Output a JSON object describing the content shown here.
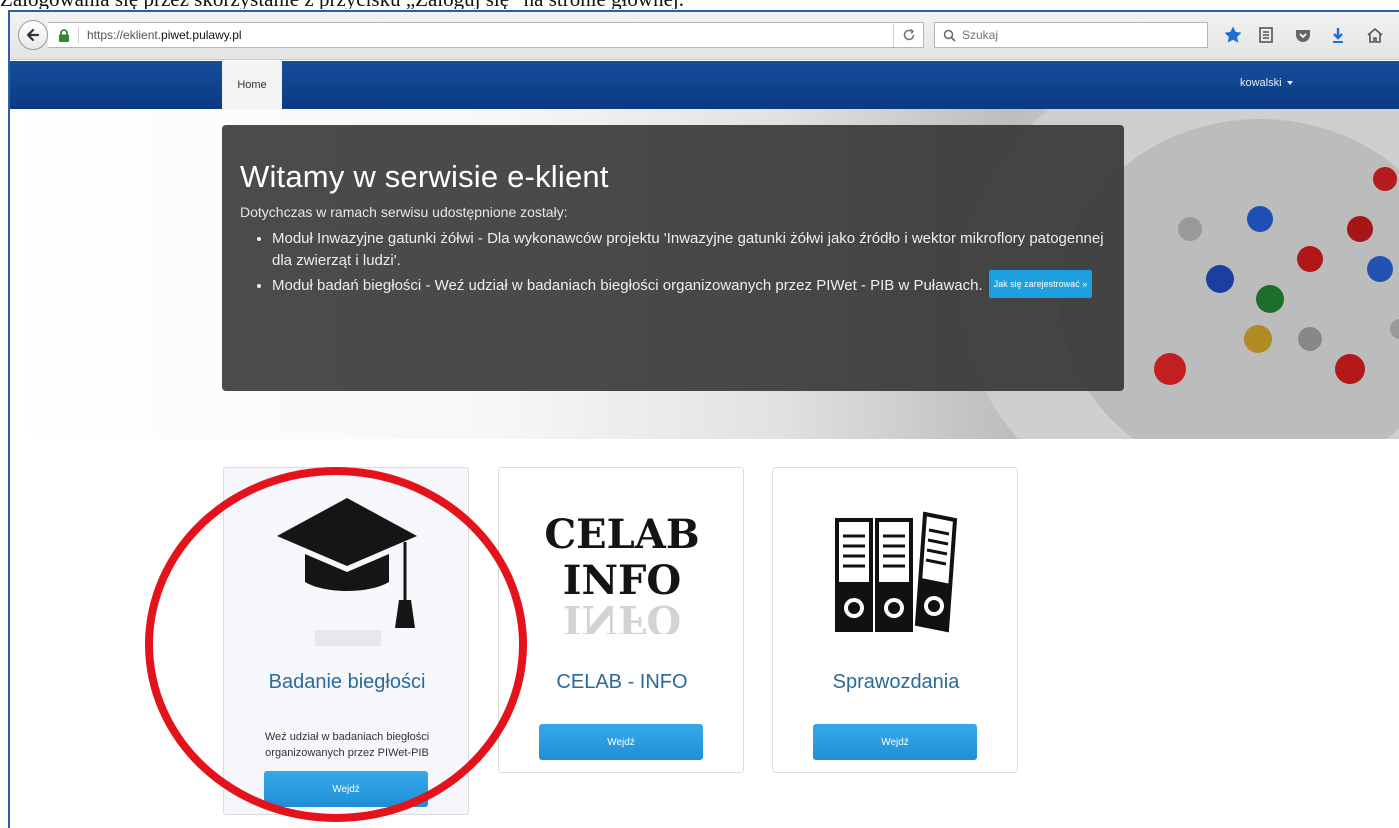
{
  "caption": "Zalogowania się przez skorzystanie z przycisku „Zaloguj się” na stronie głównej.",
  "browser": {
    "url_prefix": "https://eklient.",
    "url_domain": "piwet.pulawy.pl",
    "search_placeholder": "Szukaj"
  },
  "nav": {
    "home": "Home",
    "user": "kowalski"
  },
  "hero": {
    "title": "Witamy w serwisie e-klient",
    "subtitle": "Dotychczas w ramach serwisu udostępnione zostały:",
    "items": [
      "Moduł Inwazyjne gatunki żółwi - Dla wykonawców projektu 'Inwazyjne gatunki żółwi jako źródło i wektor mikroflory patogennej dla zwierząt i ludzi'.",
      "Moduł badań biegłości - Weź udział w badaniach biegłości organizowanych przez PIWet - PIB w Puławach."
    ],
    "register_button": "Jak się zarejestrować »"
  },
  "cards": [
    {
      "title": "Badanie biegłości",
      "description": "Weź udział w badaniach biegłości organizowanych przez PIWet-PIB",
      "button": "Wejdź",
      "icon": "graduation-cap-icon"
    },
    {
      "title": "CELAB - INFO",
      "logo_line1": "CELAB",
      "logo_line2": "INFO",
      "button": "Wejdź",
      "icon": "celab-info-logo"
    },
    {
      "title": "Sprawozdania",
      "button": "Wejdź",
      "icon": "binders-icon"
    }
  ],
  "colors": {
    "navbar": "#0b3a82",
    "accent_button": "#1e8fd6",
    "highlight_circle": "#e4131b",
    "card_title": "#2b6a99"
  }
}
